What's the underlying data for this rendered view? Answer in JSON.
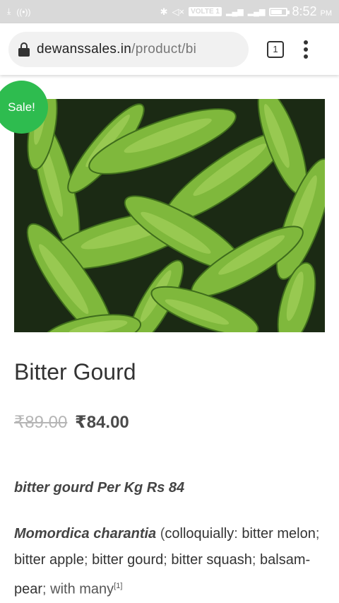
{
  "status_bar": {
    "network": "VOLTE 1",
    "signal_1": "4G",
    "time": "8:52",
    "ampm": "PM"
  },
  "browser": {
    "url_domain": "dewanssales.in",
    "url_path": "/product/bi",
    "tab_count": "1"
  },
  "product": {
    "sale_badge": "Sale!",
    "title": "Bitter Gourd",
    "price_old": "₹89.00",
    "price_new": "₹84.00",
    "short_description": "bitter gourd Per Kg Rs 84",
    "description": {
      "scientific_name": "Momordica charantia",
      "open_paren": " (",
      "link_colloquially": "colloquially",
      "colon": ": ",
      "link_bitter_melon": "bitter melon",
      "sep1": "; ",
      "link_bitter_apple": "bitter apple",
      "sep2": "; ",
      "link_bitter_gourd": "bitter gourd",
      "sep3": "; ",
      "link_bitter_squash": "bitter squash",
      "sep4": "; ",
      "link_balsam_pear": "balsam-pear",
      "tail": "; with many",
      "ref_mark": "[1]"
    },
    "image": {
      "subject": "pile of bitter gourd vegetables",
      "base_color": "#1b2a14",
      "gourd_color": "#7fb83c",
      "highlight_color": "#b7de6a"
    }
  }
}
